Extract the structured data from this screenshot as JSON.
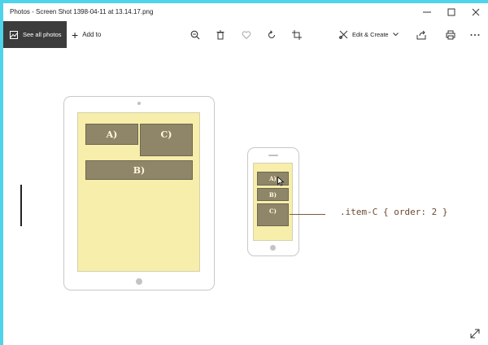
{
  "window": {
    "title": "Photos - Screen Shot 1398-04-11 at 13.14.17.png"
  },
  "toolbar": {
    "see_all_label": "See all photos",
    "add_to_label": "Add to",
    "edit_create_label": "Edit & Create"
  },
  "tablet": {
    "block_a": "A)",
    "block_b": "B)",
    "block_c": "C)"
  },
  "phone": {
    "block_a": "A)",
    "block_b": "B)",
    "block_c": "C)"
  },
  "annotation": {
    "code": ".item-C { order: 2 }"
  }
}
